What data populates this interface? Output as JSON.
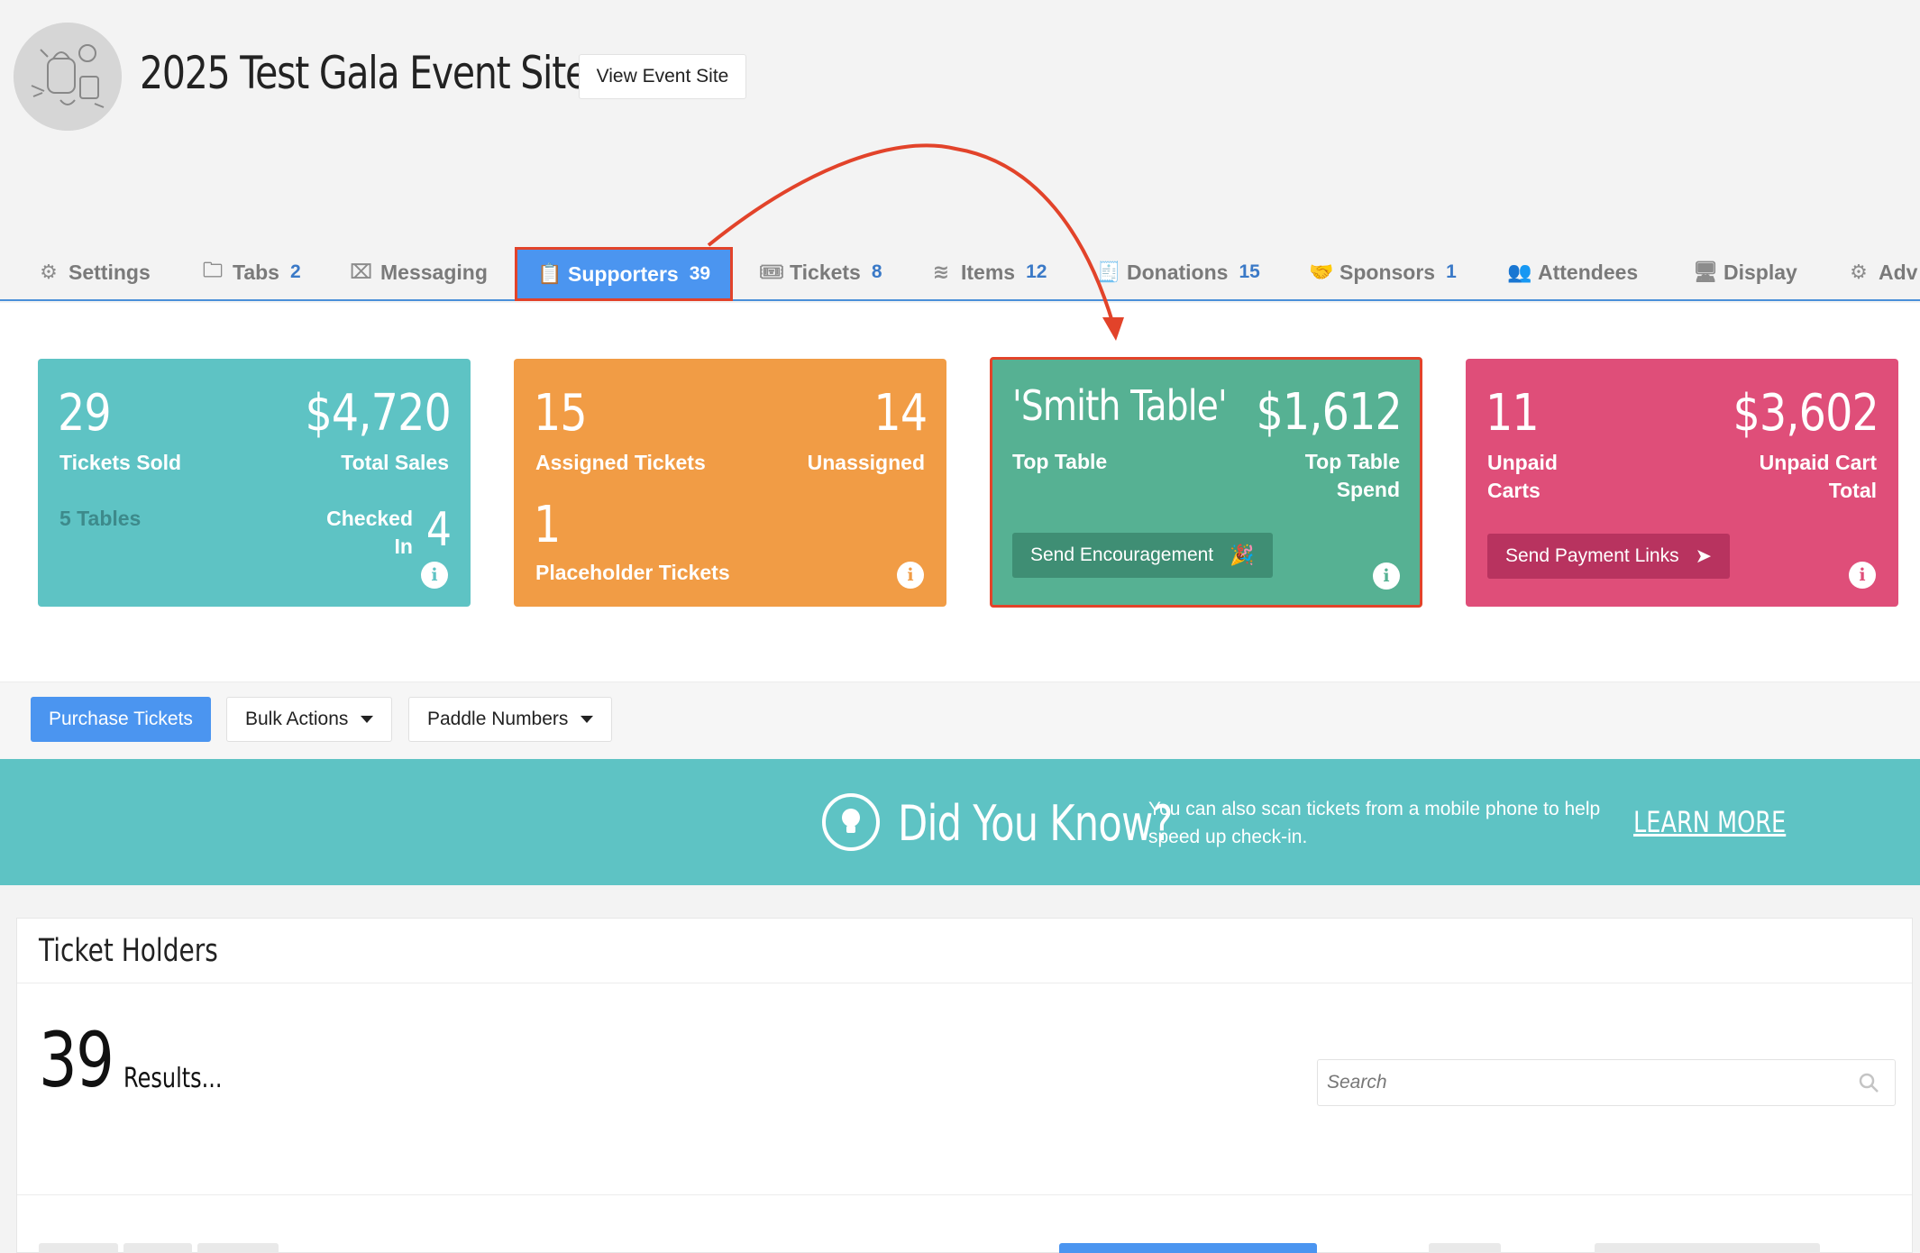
{
  "header": {
    "title": "2025 Test Gala Event Site",
    "view_site_label": "View Event Site",
    "avatar_icon": "doodle-avatar-icon"
  },
  "tabs": [
    {
      "label": "Settings",
      "icon": "gear-icon"
    },
    {
      "label": "Tabs",
      "count": "2",
      "icon": "folder-icon"
    },
    {
      "label": "Messaging",
      "icon": "inbox-icon"
    },
    {
      "label": "Supporters",
      "count": "39",
      "icon": "clipboard-icon",
      "active": true
    },
    {
      "label": "Tickets",
      "count": "8",
      "icon": "ticket-icon"
    },
    {
      "label": "Items",
      "count": "12",
      "icon": "layers-icon"
    },
    {
      "label": "Donations",
      "count": "15",
      "icon": "receipt-icon"
    },
    {
      "label": "Sponsors",
      "count": "1",
      "icon": "handshake-icon"
    },
    {
      "label": "Attendees",
      "icon": "users-icon"
    },
    {
      "label": "Display",
      "icon": "monitor-icon"
    },
    {
      "label": "Adv",
      "icon": "gears-icon"
    }
  ],
  "cards": {
    "tickets": {
      "sold_value": "29",
      "sold_label": "Tickets Sold",
      "sales_value": "$4,720",
      "sales_label": "Total Sales",
      "tables_label": "5 Tables",
      "checked_in_label": "Checked In",
      "checked_in_value": "4",
      "info": "i"
    },
    "assigned": {
      "assigned_value": "15",
      "assigned_label": "Assigned Tickets",
      "unassigned_value": "14",
      "unassigned_label": "Unassigned",
      "placeholder_value": "1",
      "placeholder_label": "Placeholder Tickets",
      "info": "i"
    },
    "top_table": {
      "name": "'Smith Table'",
      "name_label": "Top Table",
      "spend_value": "$1,612",
      "spend_label": "Top Table Spend",
      "button_label": "Send Encouragement",
      "button_icon": "party-popper-icon",
      "info": "i"
    },
    "unpaid": {
      "carts_value": "11",
      "carts_label": "Unpaid Carts",
      "total_value": "$3,602",
      "total_label": "Unpaid Cart Total",
      "button_label": "Send Payment Links",
      "button_icon": "paper-plane-icon",
      "info": "i"
    }
  },
  "actions": {
    "purchase_label": "Purchase Tickets",
    "bulk_label": "Bulk Actions",
    "paddle_label": "Paddle Numbers"
  },
  "banner": {
    "title": "Did You Know?",
    "text": "You can also scan tickets from a mobile phone to help speed up check-in.",
    "link_label": "LEARN MORE"
  },
  "ticket_holders": {
    "title": "Ticket Holders",
    "results_count": "39",
    "results_label": "Results...",
    "search_placeholder": "Search"
  },
  "colors": {
    "primary": "#4b95f0",
    "teal": "#5ec3c4",
    "orange": "#f19c45",
    "green": "#56b193",
    "pink": "#df4e79",
    "annotation_red": "#e2432a"
  }
}
